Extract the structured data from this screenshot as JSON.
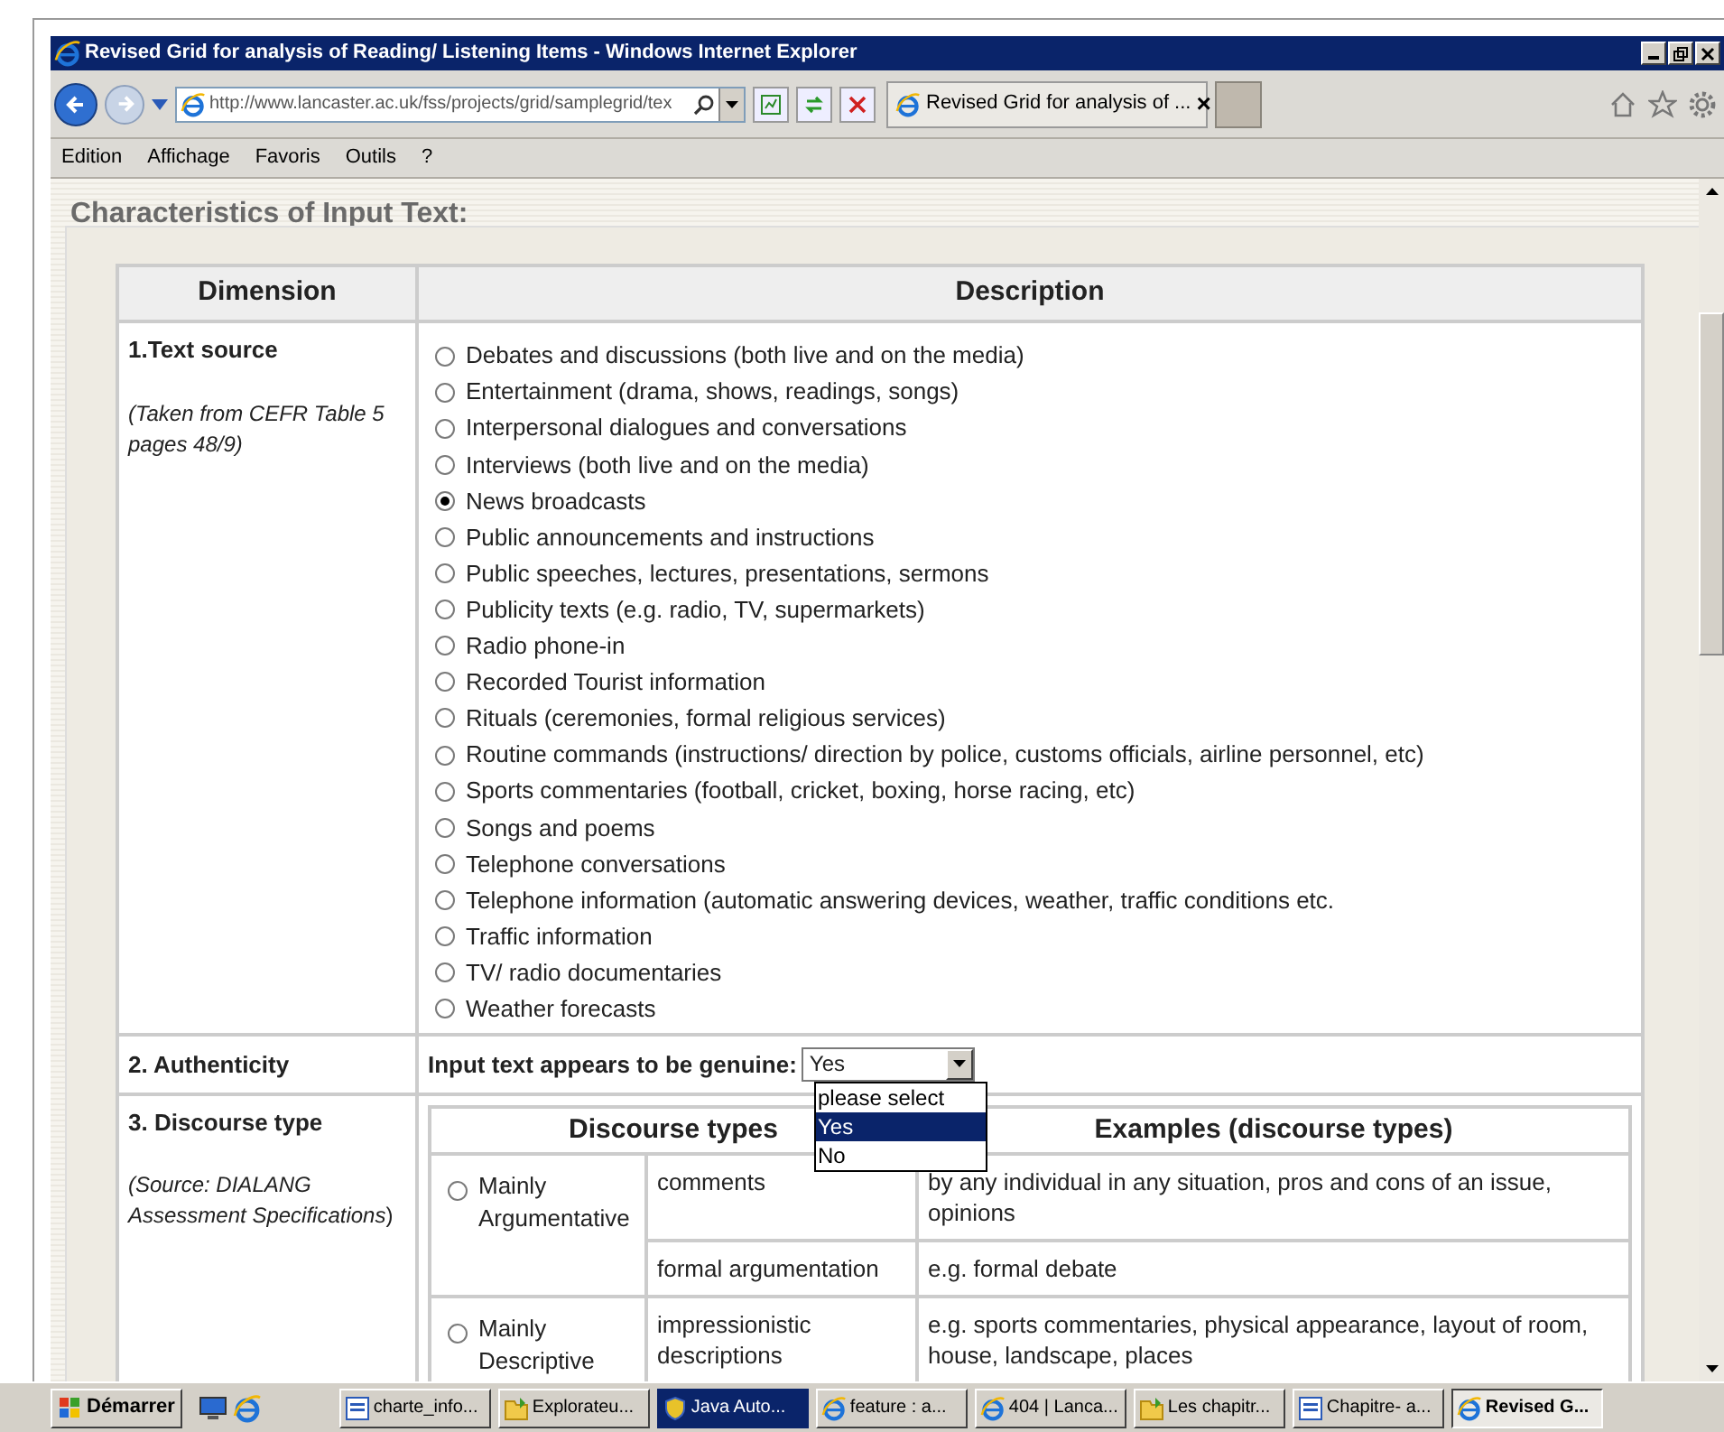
{
  "window": {
    "title": "Revised Grid for analysis of Reading/ Listening Items - Windows Internet Explorer"
  },
  "address_bar": {
    "value": "http://www.lancaster.ac.uk/fss/projects/grid/samplegrid/tex"
  },
  "tab": {
    "label": "Revised Grid for analysis of ...",
    "close": "×"
  },
  "menu": [
    "Edition",
    "Affichage",
    "Favoris",
    "Outils",
    "?"
  ],
  "page": {
    "heading": "Characteristics of Input Text:",
    "table": {
      "columns": [
        "Dimension",
        "Description"
      ],
      "text_source": {
        "label": "1.Text source",
        "note": "(Taken from CEFR Table 5 pages 48/9)",
        "options": [
          {
            "label": "Debates and discussions (both live and on the media)",
            "selected": false
          },
          {
            "label": "Entertainment (drama, shows, readings, songs)",
            "selected": false
          },
          {
            "label": "Interpersonal dialogues and conversations",
            "selected": false
          },
          {
            "label": "Interviews (both live and on the media)",
            "selected": false
          },
          {
            "label": "News broadcasts",
            "selected": true
          },
          {
            "label": "Public announcements and instructions",
            "selected": false
          },
          {
            "label": "Public speeches, lectures, presentations, sermons",
            "selected": false
          },
          {
            "label": "Publicity texts (e.g. radio, TV, supermarkets)",
            "selected": false
          },
          {
            "label": "Radio phone-in",
            "selected": false
          },
          {
            "label": "Recorded Tourist information",
            "selected": false
          },
          {
            "label": "Rituals (ceremonies, formal religious services)",
            "selected": false
          },
          {
            "label": "Routine commands (instructions/ direction by police, customs officials, airline personnel, etc)",
            "selected": false
          },
          {
            "label": "Sports commentaries (football, cricket, boxing, horse racing, etc)",
            "selected": false
          },
          {
            "label": "Songs and poems",
            "selected": false
          },
          {
            "label": "Telephone conversations",
            "selected": false
          },
          {
            "label": "Telephone information (automatic answering devices, weather, traffic conditions etc.",
            "selected": false
          },
          {
            "label": "Traffic information",
            "selected": false
          },
          {
            "label": "TV/ radio documentaries",
            "selected": false
          },
          {
            "label": "Weather forecasts",
            "selected": false
          }
        ]
      },
      "authenticity": {
        "label": "2. Authenticity",
        "question": "Input text appears to be genuine:",
        "value": "Yes",
        "dropdown_options": [
          {
            "label": "please select",
            "selected": false
          },
          {
            "label": "Yes",
            "selected": true
          },
          {
            "label": "No",
            "selected": false
          }
        ]
      },
      "discourse_type": {
        "label": "3. Discourse type",
        "note_italic": "(Source: DIALANG Assessment Specifications",
        "note_end": ")",
        "columns": [
          "Discourse types",
          "Examples (discourse types)"
        ],
        "groups": [
          {
            "label": "Mainly Argumentative",
            "selected": false,
            "rows": [
              {
                "type": "comments",
                "example": "by any individual in any situation, pros and cons of an issue, opinions"
              },
              {
                "type": "formal argumentation",
                "example": "e.g. formal debate"
              }
            ]
          },
          {
            "label": "Mainly Descriptive",
            "selected": false,
            "rows": [
              {
                "type": "impressionistic descriptions",
                "example": "e.g. sports commentaries, physical appearance, layout of room, house, landscape, places"
              }
            ]
          }
        ]
      }
    }
  },
  "taskbar": {
    "start": "Démarrer",
    "tasks": [
      {
        "label": "charte_info...",
        "kind": "doc",
        "selected": false
      },
      {
        "label": "Explorateu...",
        "kind": "folder",
        "selected": false
      },
      {
        "label": "Java Auto...",
        "kind": "shield",
        "selected": false,
        "flashing": true
      },
      {
        "label": "feature : a...",
        "kind": "ie",
        "selected": false
      },
      {
        "label": "404 | Lanca...",
        "kind": "ie",
        "selected": false
      },
      {
        "label": "Les chapitr...",
        "kind": "folder",
        "selected": false
      },
      {
        "label": "Chapitre- a...",
        "kind": "doc",
        "selected": false
      },
      {
        "label": "Revised G...",
        "kind": "ie",
        "selected": true
      }
    ]
  }
}
